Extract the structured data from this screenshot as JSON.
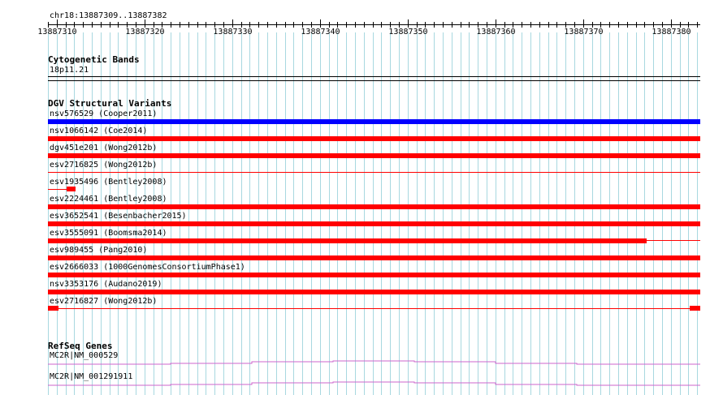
{
  "browser": {
    "location": "chr18:13887309..13887382",
    "ruler": {
      "labels": [
        "13887310",
        "13887320",
        "13887330",
        "13887340",
        "13887350",
        "13887360",
        "13887370",
        "13887380"
      ]
    },
    "tracks": {
      "cytoband": {
        "title": "Cytogenetic Bands",
        "band": "18p11.21"
      },
      "dgv": {
        "title": "DGV Structural Variants",
        "items": [
          {
            "label": "nsv576529 (Cooper2011)"
          },
          {
            "label": "nsv1066142 (Coe2014)"
          },
          {
            "label": "dgv451e201 (Wong2012b)"
          },
          {
            "label": "esv2716825 (Wong2012b)"
          },
          {
            "label": "esv1935496 (Bentley2008)"
          },
          {
            "label": "esv2224461 (Bentley2008)"
          },
          {
            "label": "esv3652541 (Besenbacher2015)"
          },
          {
            "label": "esv3555091 (Boomsma2014)"
          },
          {
            "label": "esv989455 (Pang2010)"
          },
          {
            "label": "esv2666033 (1000GenomesConsortiumPhase1)"
          },
          {
            "label": "nsv3353176 (Audano2019)"
          },
          {
            "label": "esv2716827 (Wong2012b)"
          }
        ]
      },
      "refseq": {
        "title": "RefSeq Genes",
        "genes": [
          {
            "label": "MC2R|NM_000529"
          },
          {
            "label": "MC2R|NM_001291911"
          }
        ]
      }
    },
    "colors": {
      "grid": "#a8d8e0",
      "sv_loss": "#ff0000",
      "sv_gain": "#0000ff",
      "gene": "#cc66cc"
    }
  }
}
